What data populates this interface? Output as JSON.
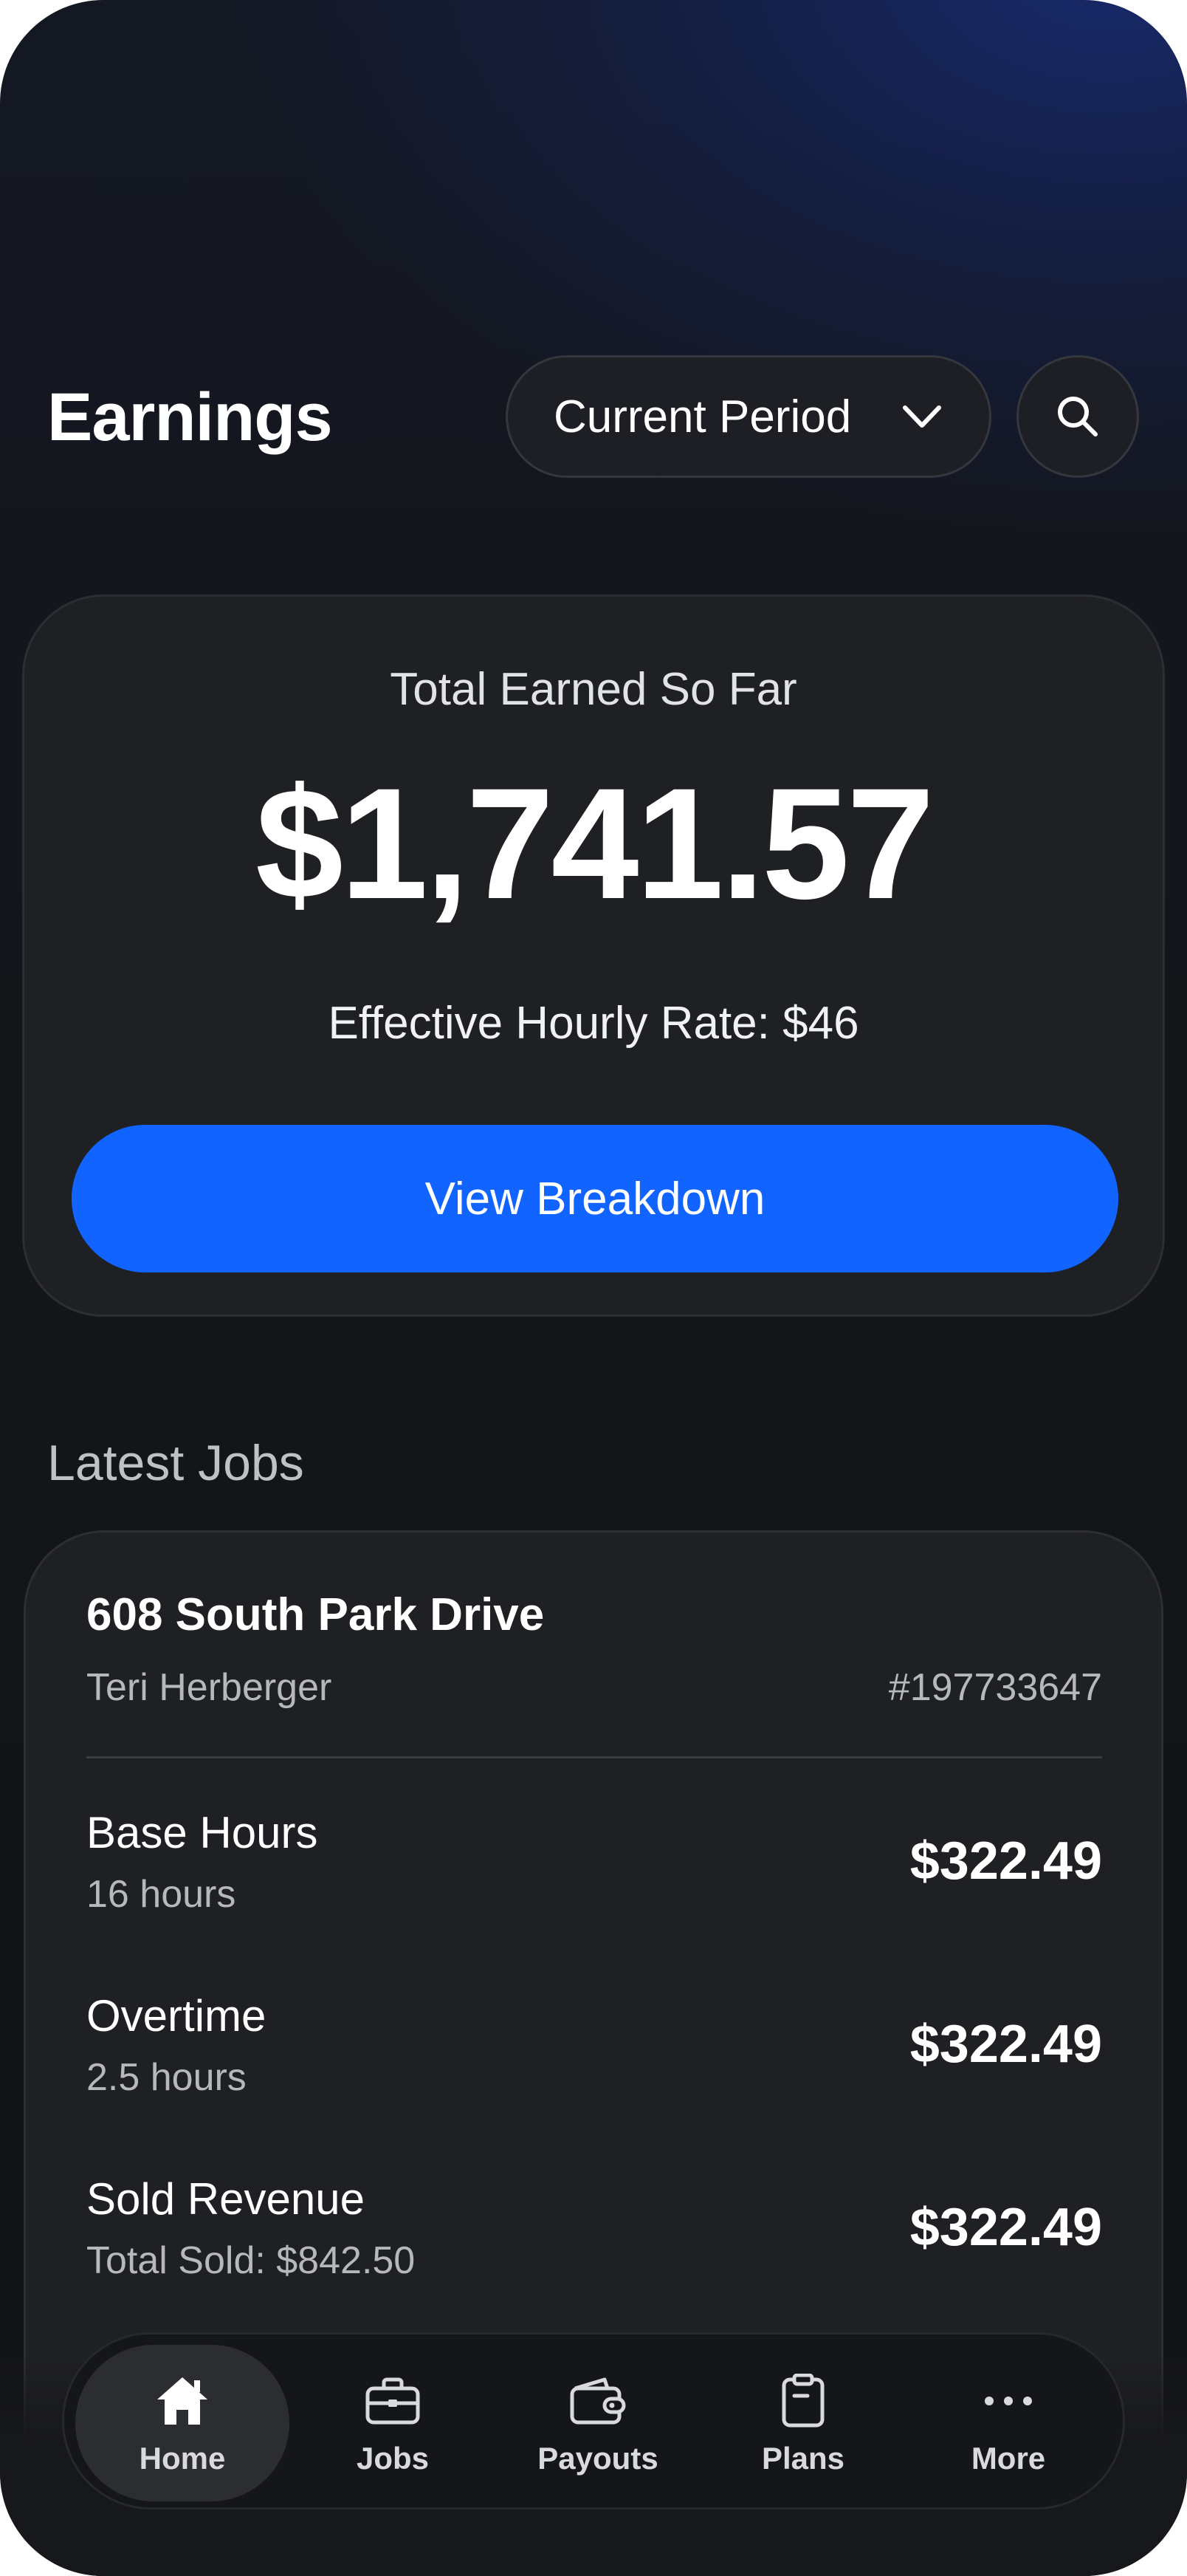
{
  "header": {
    "title": "Earnings",
    "period_select": {
      "selected": "Current Period",
      "icon": "chevron-down-icon"
    },
    "search_icon": "search-icon"
  },
  "summary": {
    "label": "Total Earned So Far",
    "amount": "$1,741.57",
    "rate": "Effective Hourly Rate: $46",
    "button_label": "View Breakdown"
  },
  "jobs_section": {
    "title": "Latest Jobs",
    "job": {
      "address": "608 South Park Drive",
      "customer": "Teri Herberger",
      "number": "#197733647",
      "items": [
        {
          "label": "Base Hours",
          "sub": "16 hours",
          "amount": "$322.49"
        },
        {
          "label": "Overtime",
          "sub": "2.5 hours",
          "amount": "$322.49"
        },
        {
          "label": "Sold Revenue",
          "sub": "Total Sold: $842.50",
          "amount": "$322.49"
        }
      ]
    }
  },
  "tabbar": {
    "tabs": [
      {
        "label": "Home",
        "icon": "home-icon",
        "active": true
      },
      {
        "label": "Jobs",
        "icon": "briefcase-icon",
        "active": false
      },
      {
        "label": "Payouts",
        "icon": "wallet-icon",
        "active": false
      },
      {
        "label": "Plans",
        "icon": "clipboard-icon",
        "active": false
      },
      {
        "label": "More",
        "icon": "more-dots-icon",
        "active": false
      }
    ]
  },
  "colors": {
    "accent": "#1164ff",
    "card": "#1f2023",
    "background": "#131416"
  }
}
